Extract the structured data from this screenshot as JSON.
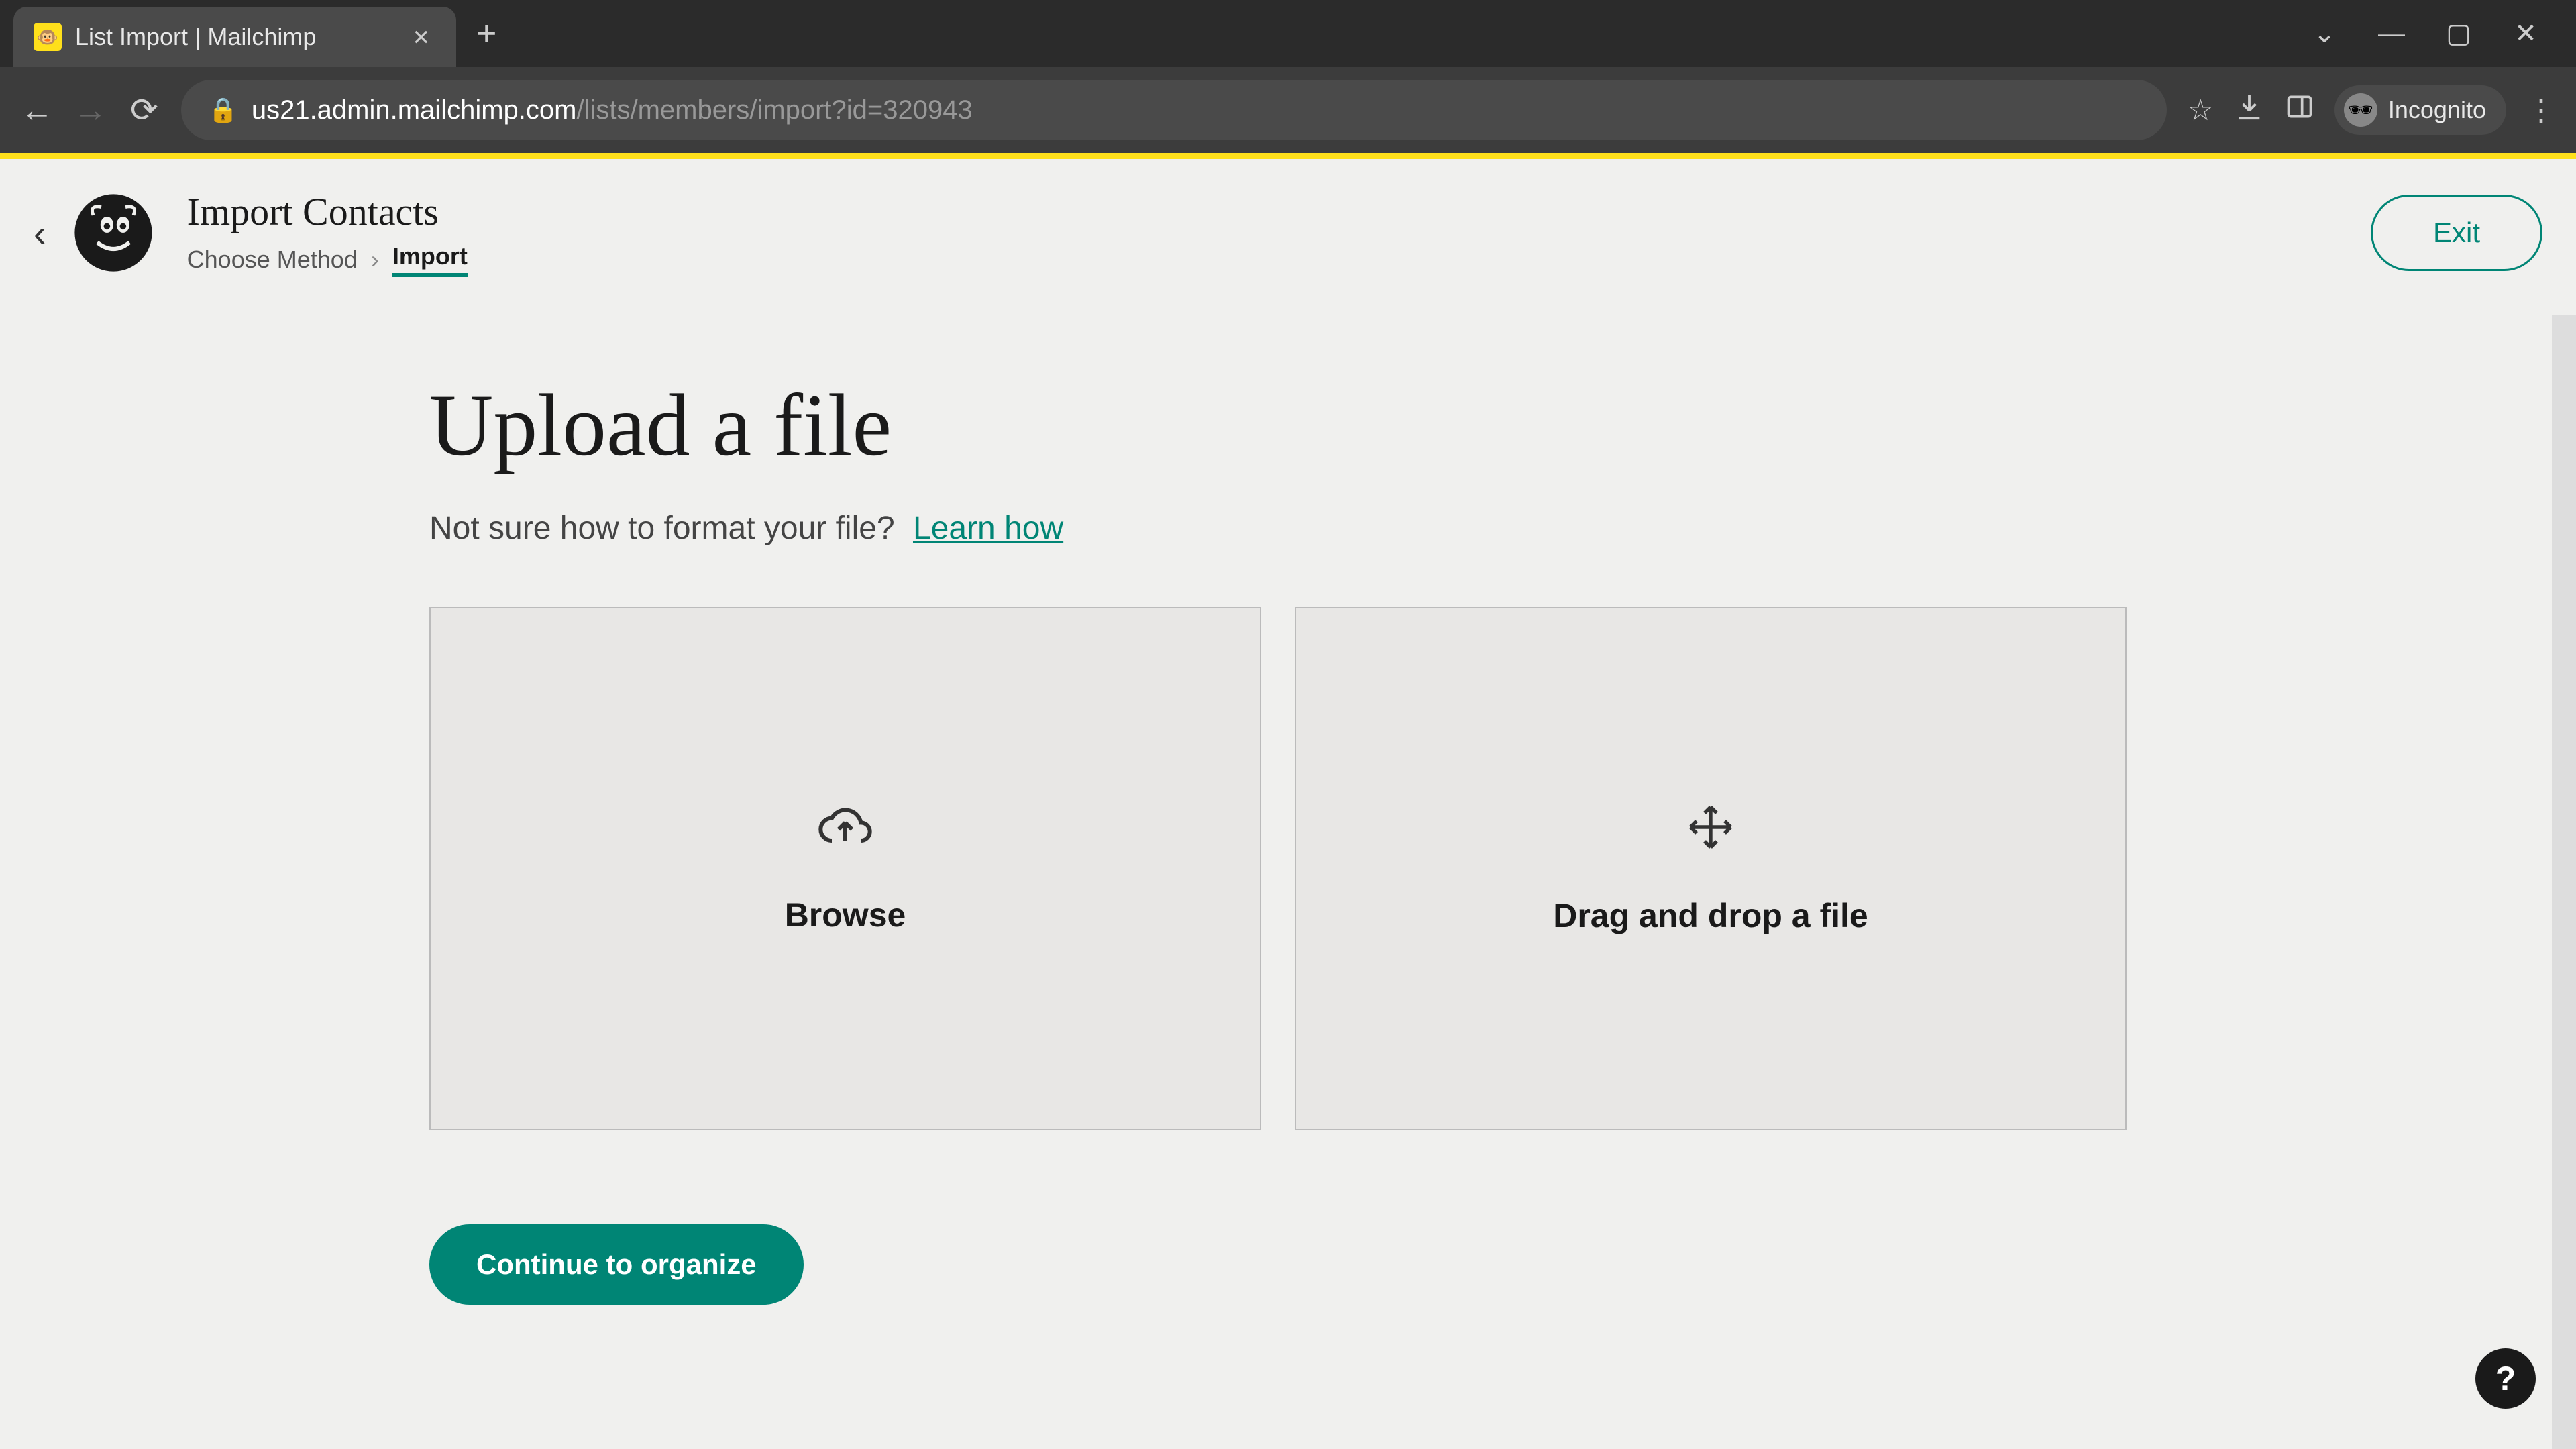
{
  "browser": {
    "tab_title": "List Import | Mailchimp",
    "url_domain": "us21.admin.mailchimp.com",
    "url_path": "/lists/members/import?id=320943",
    "incognito_label": "Incognito"
  },
  "header": {
    "title": "Import Contacts",
    "breadcrumb": {
      "step1": "Choose Method",
      "step2": "Import"
    },
    "exit_label": "Exit"
  },
  "main": {
    "heading": "Upload a file",
    "subtitle": "Not sure how to format your file?",
    "learn_link": "Learn how",
    "browse_label": "Browse",
    "dragdrop_label": "Drag and drop a file",
    "continue_label": "Continue to organize"
  },
  "help": {
    "label": "?"
  }
}
